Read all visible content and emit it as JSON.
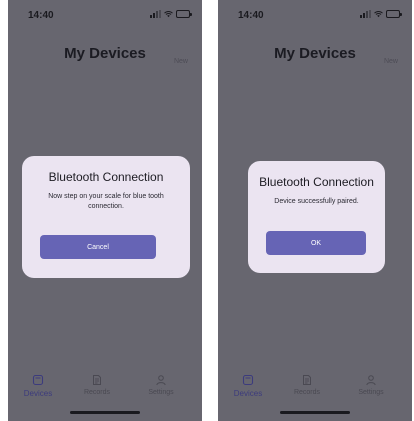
{
  "screens": [
    {
      "status": {
        "time": "14:40",
        "battery_level_percent": 80
      },
      "page_title": "My Devices",
      "new_label": "New",
      "dialog": {
        "title": "Bluetooth Connection",
        "message": "Now step on your scale for blue tooth connection.",
        "button_label": "Cancel"
      },
      "tabs": [
        {
          "label": "Devices",
          "icon": "device-icon",
          "active": true
        },
        {
          "label": "Records",
          "icon": "records-icon",
          "active": false
        },
        {
          "label": "Settings",
          "icon": "person-icon",
          "active": false
        }
      ]
    },
    {
      "status": {
        "time": "14:40",
        "battery_level_percent": 80
      },
      "page_title": "My Devices",
      "new_label": "New",
      "dialog": {
        "title": "Bluetooth Connection",
        "message": "Device successfully paired.",
        "button_label": "OK"
      },
      "tabs": [
        {
          "label": "Devices",
          "icon": "device-icon",
          "active": true
        },
        {
          "label": "Records",
          "icon": "records-icon",
          "active": false
        },
        {
          "label": "Settings",
          "icon": "person-icon",
          "active": false
        }
      ]
    }
  ],
  "colors": {
    "overlay": "#67666f",
    "dialog_background": "#ebe4f1",
    "primary_button": "#6664b5",
    "active_tab": "#3c3b7d",
    "battery": "#b8b82a"
  }
}
